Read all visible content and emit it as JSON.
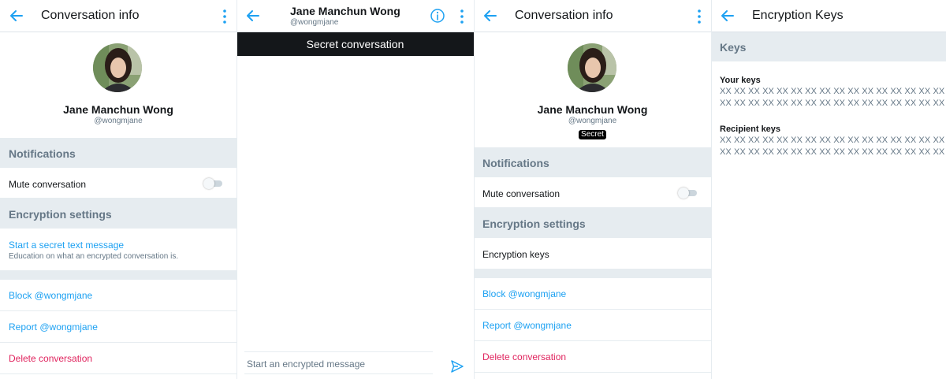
{
  "panel1": {
    "title": "Conversation info",
    "profile": {
      "name": "Jane Manchun Wong",
      "handle": "@wongmjane"
    },
    "notifications_header": "Notifications",
    "mute_label": "Mute conversation",
    "mute_on": false,
    "encryption_header": "Encryption settings",
    "secret_link": "Start a secret text message",
    "secret_sub": "Education on what an encrypted conversation is.",
    "block_label": "Block @wongmjane",
    "report_label": "Report @wongmjane",
    "delete_label": "Delete conversation"
  },
  "panel2": {
    "title": "Jane Manchun Wong",
    "handle": "@wongmjane",
    "banner": "Secret conversation",
    "compose_placeholder": "Start an encrypted message"
  },
  "panel3": {
    "title": "Conversation info",
    "profile": {
      "name": "Jane Manchun Wong",
      "handle": "@wongmjane",
      "badge": "Secret"
    },
    "notifications_header": "Notifications",
    "mute_label": "Mute conversation",
    "mute_on": false,
    "encryption_header": "Encryption settings",
    "keys_label": "Encryption keys",
    "block_label": "Block @wongmjane",
    "report_label": "Report @wongmjane",
    "delete_label": "Delete conversation"
  },
  "panel4": {
    "title": "Encryption Keys",
    "section": "Keys",
    "your_keys_label": "Your keys",
    "your_keys": [
      "XX XX XX XX XX XX XX XX XX XX XX XX XX XX XX XX",
      "XX XX XX XX XX XX XX XX XX XX XX XX XX XX XX XX"
    ],
    "recipient_keys_label": "Recipient keys",
    "recipient_keys": [
      "XX XX XX XX XX XX XX XX XX XX XX XX XX XX XX XX",
      "XX XX XX XX XX XX XX XX XX XX XX XX XX XX XX XX"
    ]
  },
  "colors": {
    "accent": "#1da1f2",
    "danger": "#e0245e",
    "section_bg": "#e6ecf0",
    "muted": "#657786"
  },
  "icons": {
    "back": "arrow-left-icon",
    "more": "kebab-icon",
    "info": "info-icon",
    "send": "send-icon"
  }
}
